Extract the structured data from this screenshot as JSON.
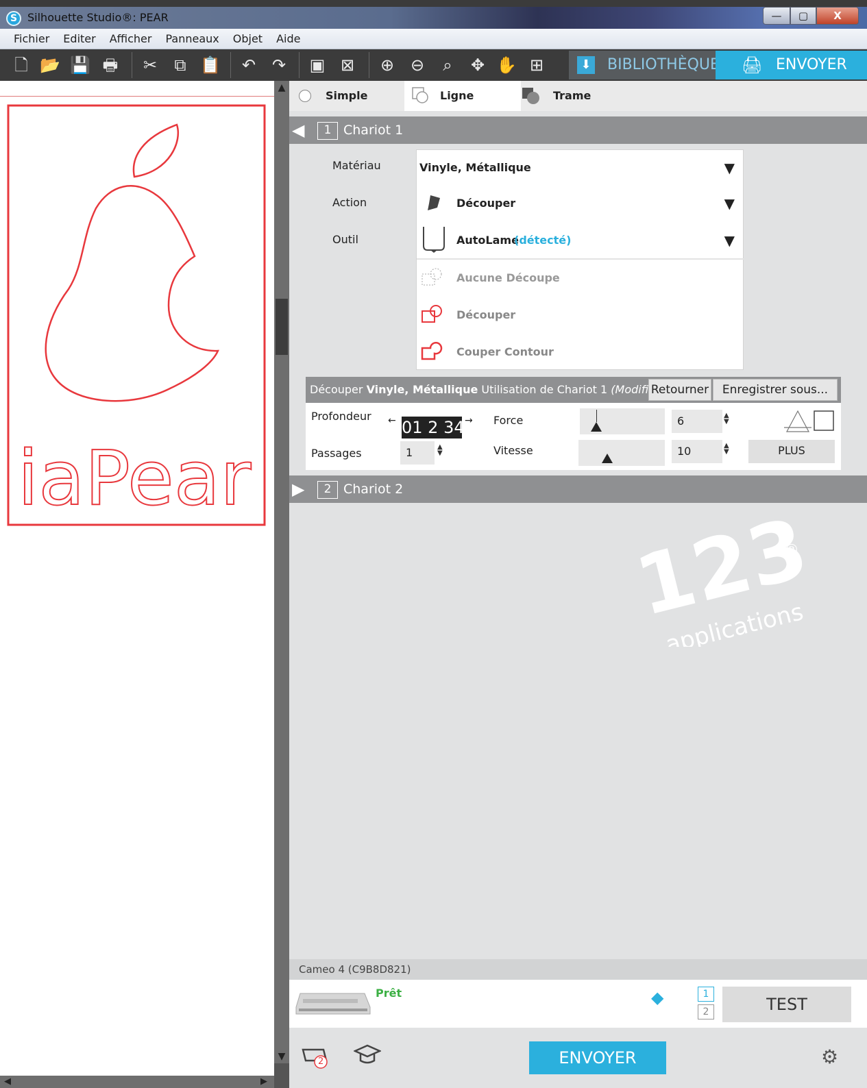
{
  "window": {
    "title": "Silhouette Studio®: PEAR",
    "logo_letter": "S",
    "controls": [
      "—",
      "▢",
      "X"
    ]
  },
  "menu": [
    "Fichier",
    "Editer",
    "Afficher",
    "Panneaux",
    "Objet",
    "Aide"
  ],
  "toolbar": {
    "icons": [
      "new-document-icon",
      "open-folder-icon",
      "save-icon",
      "print-icon",
      "cut-icon",
      "copy-icon",
      "paste-icon",
      "undo-icon",
      "redo-icon",
      "group-icon",
      "ungroup-icon",
      "zoom-in-icon",
      "zoom-out-icon",
      "zoom-fit-icon",
      "move-icon",
      "pan-hand-icon",
      "fit-page-icon"
    ],
    "library_tab": "BIBLIOTHÈQUE",
    "send_tab": "ENVOYER"
  },
  "canvas": {
    "design_text": "iaPear",
    "stroke_color": "#e8383d"
  },
  "mode_tabs": {
    "simple": "Simple",
    "ligne": "Ligne",
    "trame": "Trame"
  },
  "chariot1": {
    "number": "1",
    "label": "Chariot 1",
    "material_label": "Matériau",
    "material_value": "Vinyle, Métallique",
    "action_label": "Action",
    "action_value": "Découper",
    "tool_label": "Outil",
    "tool_value": "AutoLame",
    "tool_detected": "(détecté)",
    "options": [
      "Aucune Découpe",
      "Découper",
      "Couper Contour"
    ]
  },
  "settings": {
    "hdr_prefix": "Découper",
    "hdr_material": "Vinyle, Métallique",
    "hdr_middle": "Utilisation de Chariot 1",
    "hdr_modified": "(Modifié)",
    "return_btn": "Retourner",
    "save_as_btn": "Enregistrer sous...",
    "depth_label": "Profondeur de lame",
    "depth_scale": "01 2 34",
    "passes_label": "Passages",
    "passes_value": "1",
    "force_label": "Force",
    "force_value": "6",
    "speed_label": "Vitesse",
    "speed_value": "10",
    "more_btn": "PLUS"
  },
  "chariot2": {
    "number": "2",
    "label": "Chariot 2"
  },
  "watermark": {
    "number": "123",
    "text": "applications",
    "reg": "®"
  },
  "device": {
    "name": "Cameo 4 (C9B8D821)",
    "status": "Prêt",
    "page1": "1",
    "page2": "2",
    "test_btn": "TEST",
    "send_btn": "ENVOYER",
    "cutter_badge": "2"
  }
}
